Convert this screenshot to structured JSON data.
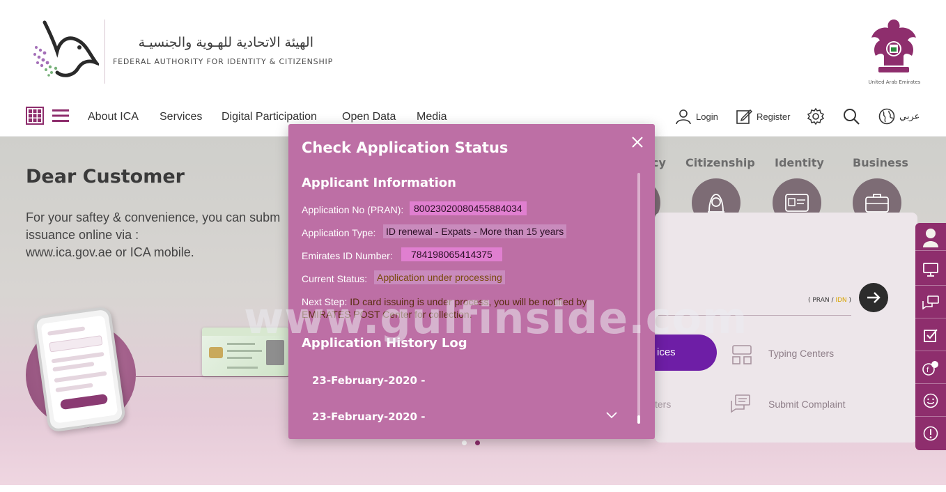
{
  "header": {
    "logo_ar": "الهيئة الاتحادية للهـوية والجنسيـة",
    "logo_en": "FEDERAL AUTHORITY FOR IDENTITY & CITIZENSHIP",
    "emblem_caption": "United Arab Emirates"
  },
  "nav": {
    "items": [
      "About ICA",
      "Services",
      "Digital Participation",
      "Open Data",
      "Media"
    ],
    "login": "Login",
    "register": "Register",
    "language": "عربي"
  },
  "hero": {
    "title": "Dear Customer",
    "text_line1": "For your saftey & convenience, you can subm",
    "text_line2": "issuance online via :",
    "text_line3": "www.ica.gov.ae or ICA mobile."
  },
  "categories": {
    "partial": "cy",
    "citizenship": "Citizenship",
    "identity": "Identity",
    "business": "Business"
  },
  "panel": {
    "pran_prefix": "( PRAN / ",
    "idn": "IDN",
    "pran_suffix": " )",
    "services_partial": "ices",
    "typing_centers": "Typing Centers",
    "submit_complaint": "Submit Complaint",
    "centers_partial": "ters"
  },
  "modal": {
    "title": "Check Application Status",
    "applicant_info": "Applicant Information",
    "app_no_label": "Application No (PRAN):",
    "app_no_value": "80023020080455884034",
    "app_type_label": "Application Type:",
    "app_type_value": "ID renewal - Expats - More than 15 years",
    "eid_label": "Emirates ID Number:",
    "eid_value": "784198065414375",
    "status_label": "Current Status:",
    "status_value": "Application under processing",
    "next_step_label": "Next Step:",
    "next_step_value": "ID card issuing is under process, you will be notified by EMIRATES POST Center for collection.",
    "history_title": "Application History Log",
    "history": [
      "23-February-2020 -",
      "23-February-2020 -"
    ]
  },
  "watermark": "www.gulfinside.com",
  "colors": {
    "brand": "#8e2e6d",
    "modal_bg": "#bd6fa5",
    "accent_purple": "#6e1ea6"
  }
}
